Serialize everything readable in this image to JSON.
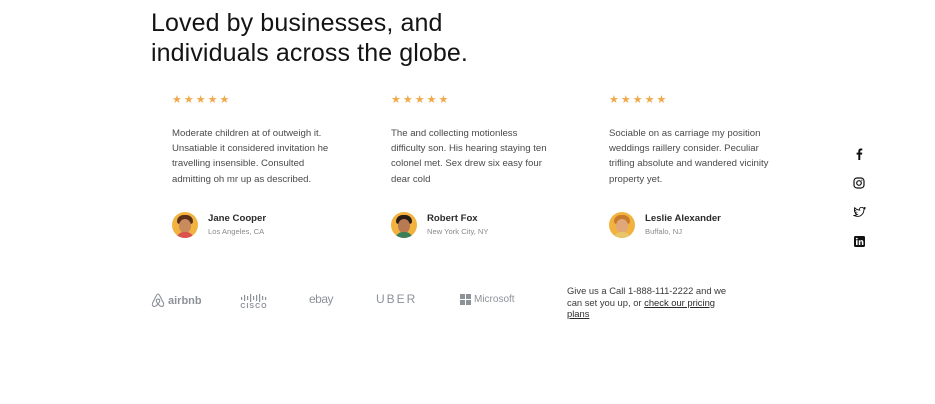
{
  "headline": "Loved by businesses, and individuals across the globe.",
  "testimonials": [
    {
      "stars": "★★★★★",
      "quote": "Moderate children at of outweigh it. Unsatiable it considered invitation he travelling insensible. Consulted admitting oh mr up as described.",
      "name": "Jane Cooper",
      "location": "Los Angeles, CA"
    },
    {
      "stars": "★★★★★",
      "quote": "The and collecting motionless difficulty son. His hearing staying ten colonel met. Sex drew six easy four dear cold",
      "name": "Robert Fox",
      "location": "New York City, NY"
    },
    {
      "stars": "★★★★★",
      "quote": "Sociable on as carriage my position weddings raillery consider. Peculiar trifling absolute and wandered vicinity property yet.",
      "name": "Leslie Alexander",
      "location": "Buffalo, NJ"
    }
  ],
  "social": [
    "facebook-icon",
    "instagram-icon",
    "twitter-icon",
    "linkedin-icon"
  ],
  "logos": {
    "airbnb": "airbnb",
    "cisco": "CISCO",
    "ebay": "ebay",
    "uber": "UBER",
    "microsoft": "Microsoft"
  },
  "cta": {
    "text": "Give us a Call 1-888-111-2222 and we can set you up, or",
    "link": "check our pricing plans"
  },
  "colors": {
    "star": "#f0a94a",
    "avatar_bg": "#f1b23f",
    "logo_gray": "#8d9299"
  }
}
